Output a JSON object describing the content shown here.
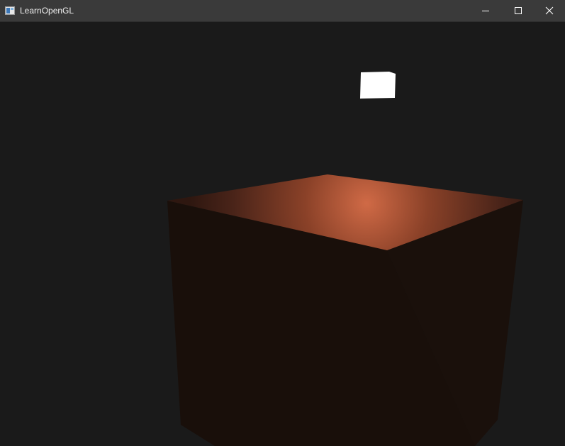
{
  "window": {
    "title": "LearnOpenGL"
  },
  "controls": {
    "minimize_icon": "minimize-icon",
    "maximize_icon": "maximize-icon",
    "close_icon": "close-icon"
  },
  "scene": {
    "clear_color": "#1a1a1a",
    "light_color": "#ffffff",
    "cube_highlight_color": "#d06a46",
    "cube_edge_color": "#2e1710",
    "cube_side_color": "#190f0a"
  }
}
